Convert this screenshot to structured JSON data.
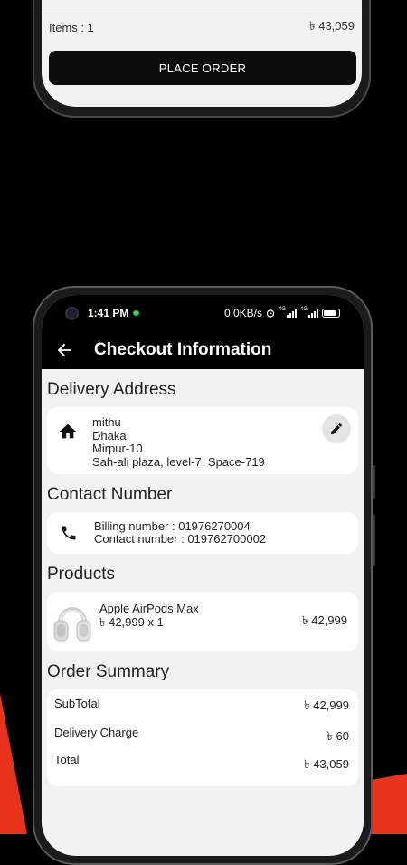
{
  "top_screen": {
    "items_label": "Items : 1",
    "items_total": "৳ 43,059",
    "place_order_label": "PLACE ORDER"
  },
  "status_bar": {
    "time": "1:41 PM",
    "network_speed": "0.0KB/s",
    "sim1": "4G",
    "sim2": "4G",
    "battery": "69"
  },
  "app_bar": {
    "title": "Checkout Information",
    "back_icon": "arrow-left-icon"
  },
  "delivery_address": {
    "title": "Delivery Address",
    "icon": "home-icon",
    "name": "mithu",
    "city": "Dhaka",
    "area": "Mirpur-10",
    "street": "Sah-ali plaza, level-7, Space-719",
    "edit_icon": "pencil-icon"
  },
  "contact": {
    "title": "Contact Number",
    "icon": "phone-icon",
    "billing": "Billing number : 01976270004",
    "contact": "Contact number : 019762700002"
  },
  "products": {
    "title": "Products",
    "items": [
      {
        "name": "Apple AirPods Max",
        "price_qty": "৳ 42,999 x 1",
        "total": "৳ 42,999"
      }
    ]
  },
  "order_summary": {
    "title": "Order Summary",
    "subtotal_label": "SubTotal",
    "subtotal_value": "৳ 42,999",
    "delivery_label": "Delivery Charge",
    "delivery_value": "৳ 60",
    "total_label": "Total",
    "total_value": "৳ 43,059"
  },
  "colors": {
    "background": "#000000",
    "accent_red": "#e8341c",
    "screen_bg": "#f2f2f2",
    "card_bg": "#ffffff"
  }
}
